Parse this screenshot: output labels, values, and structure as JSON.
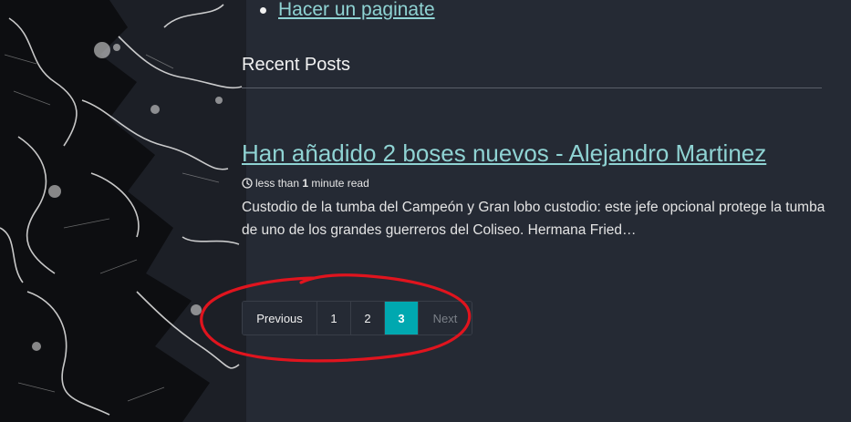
{
  "nav": {
    "items": [
      {
        "label": "Hacer un paginate"
      }
    ]
  },
  "recent_posts": {
    "heading": "Recent Posts"
  },
  "post": {
    "title": "Han añadido 2 boses nuevos - Alejandro Martinez",
    "read_prefix": "less than ",
    "read_number": "1",
    "read_suffix": " minute read",
    "excerpt": "Custodio de la tumba del Campeón y Gran lobo custodio: este jefe opcional protege la tumba de uno de los grandes guerreros del Coliseo. Hermana Fried…"
  },
  "pagination": {
    "previous": "Previous",
    "pages": [
      "1",
      "2",
      "3"
    ],
    "current_page": "3",
    "next": "Next"
  },
  "colors": {
    "background": "#252a34",
    "link": "#8fd3d3",
    "active_page": "#00a8b0",
    "annotation": "#e0141e"
  },
  "icons": {
    "read_time": "clock-icon",
    "list_bullet": "bullet-dot"
  }
}
